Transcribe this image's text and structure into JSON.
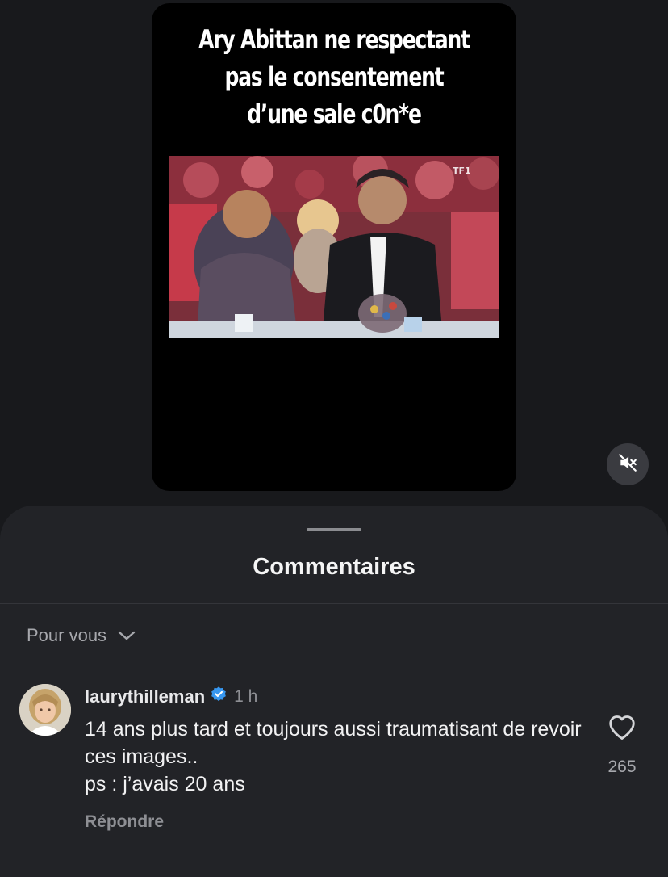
{
  "post": {
    "overlay_title_lines": [
      "Ary Abittan ne respectant",
      "pas le consentement",
      "d’une sale c0n*e"
    ],
    "video_watermark": "TF1"
  },
  "media_controls": {
    "mute_icon": "speaker-muted-icon"
  },
  "comments_sheet": {
    "title": "Commentaires",
    "filter_label": "Pour vous",
    "filter_icon": "chevron-down-icon"
  },
  "comments": [
    {
      "username": "laurythilleman",
      "verified": true,
      "time": "1 h",
      "text_lines": [
        "14 ans plus tard et toujours aussi traumatisant de revoir ces images..",
        "ps : j’avais 20 ans"
      ],
      "likes": "265",
      "reply_label": "Répondre"
    }
  ],
  "colors": {
    "background": "#18191c",
    "sheet": "#222327",
    "verified_badge": "#3797f0",
    "secondary_text": "#8e8f94"
  }
}
